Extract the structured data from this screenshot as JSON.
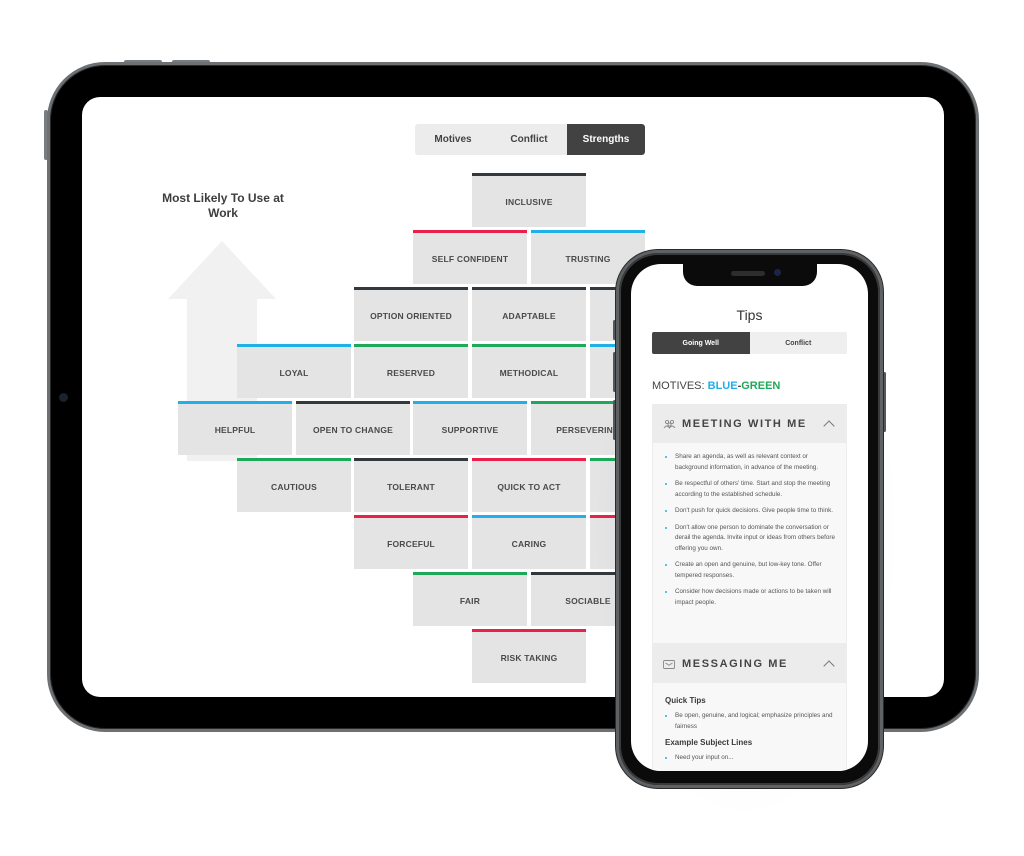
{
  "tablet": {
    "tabs": [
      {
        "label": "Motives",
        "active": false
      },
      {
        "label": "Conflict",
        "active": false
      },
      {
        "label": "Strengths",
        "active": true
      }
    ],
    "heading": "Most Likely To Use at Work",
    "colors": {
      "red": "#e8204a",
      "blue": "#1fb0e8",
      "green": "#1ea85a",
      "dark": "#33383c"
    },
    "strengths": [
      {
        "label": "INCLUSIVE",
        "color": "dark"
      },
      {
        "label": "SELF CONFIDENT",
        "color": "red"
      },
      {
        "label": "TRUSTING",
        "color": "blue"
      },
      {
        "label": "OPTION ORIENTED",
        "color": "dark"
      },
      {
        "label": "ADAPTABLE",
        "color": "dark"
      },
      {
        "label": "",
        "color": "dark"
      },
      {
        "label": "LOYAL",
        "color": "blue"
      },
      {
        "label": "RESERVED",
        "color": "green"
      },
      {
        "label": "METHODICAL",
        "color": "green"
      },
      {
        "label": "",
        "color": "blue"
      },
      {
        "label": "HELPFUL",
        "color": "blue"
      },
      {
        "label": "OPEN TO CHANGE",
        "color": "dark"
      },
      {
        "label": "SUPPORTIVE",
        "color": "blue"
      },
      {
        "label": "PERSEVERING",
        "color": "green"
      },
      {
        "label": "CAUTIOUS",
        "color": "green"
      },
      {
        "label": "TOLERANT",
        "color": "dark"
      },
      {
        "label": "QUICK TO ACT",
        "color": "red"
      },
      {
        "label": "",
        "color": "green"
      },
      {
        "label": "FORCEFUL",
        "color": "red"
      },
      {
        "label": "CARING",
        "color": "blue"
      },
      {
        "label": "",
        "color": "red"
      },
      {
        "label": "FAIR",
        "color": "green"
      },
      {
        "label": "SOCIABLE",
        "color": "dark"
      },
      {
        "label": "RISK TAKING",
        "color": "red"
      }
    ]
  },
  "phone": {
    "title": "Tips",
    "tabs": [
      {
        "label": "Going Well",
        "active": true
      },
      {
        "label": "Conflict",
        "active": false
      }
    ],
    "motives": {
      "prefix": "MOTIVES: ",
      "first": "BLUE",
      "dash": "-",
      "second": "GREEN"
    },
    "sections": [
      {
        "title": "MEETING WITH ME",
        "icon": "group-icon",
        "expanded": true,
        "items": [
          "Share an agenda, as well as relevant context or background information, in advance of the meeting.",
          "Be respectful of others' time. Start and stop the meeting according to the established schedule.",
          "Don't push for quick decisions. Give people time to think.",
          "Don't allow one person to dominate the conversation or derail the agenda. Invite input or ideas from others before offering you own.",
          "Create an open and genuine, but low-key tone. Offer tempered responses.",
          "Consider how decisions made or actions to be taken will impact people."
        ]
      },
      {
        "title": "MESSAGING ME",
        "icon": "envelope-icon",
        "expanded": true,
        "quick_tips_heading": "Quick Tips",
        "quick_tips": [
          "Be open, genuine, and logical; emphasize principles and fairness"
        ],
        "subject_lines_heading": "Example Subject Lines",
        "subject_lines": [
          "Need your input on..."
        ]
      }
    ]
  }
}
